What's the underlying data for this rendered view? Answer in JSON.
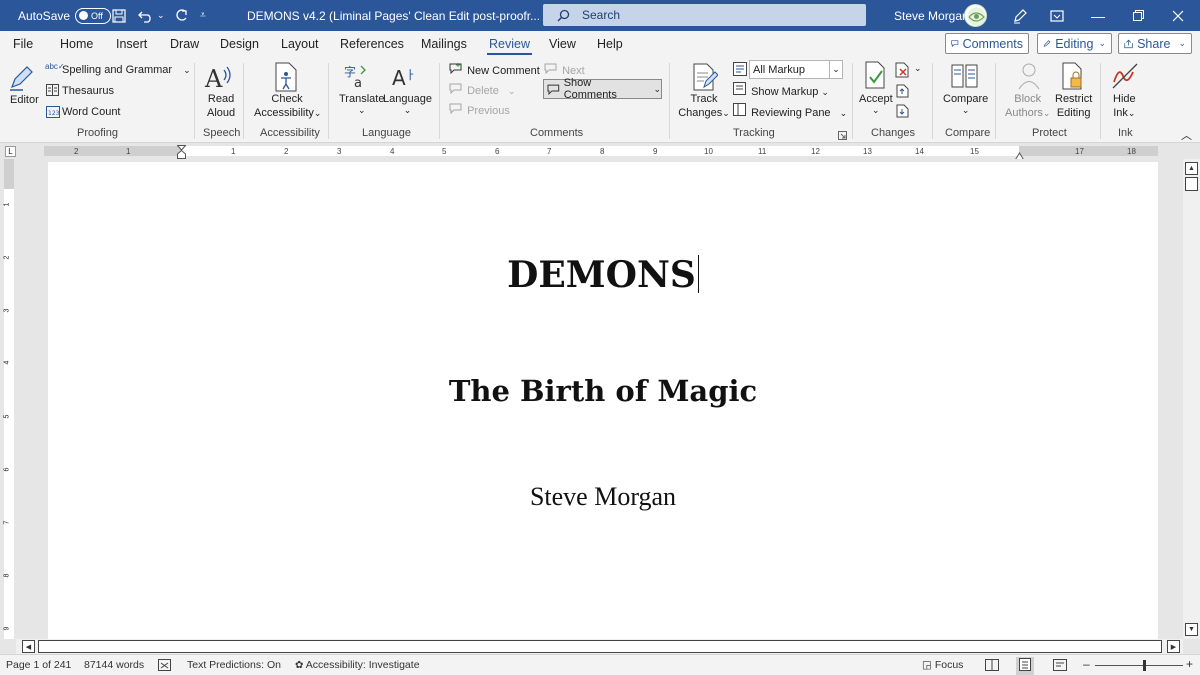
{
  "colors": {
    "accent": "#2b579a",
    "ribbon_bg": "#f3f3f3",
    "page_bg": "#ffffff"
  },
  "titlebar": {
    "autosave_label": "AutoSave",
    "autosave_state": "Off",
    "document_title": "DEMONS v4.2 (Liminal Pages' Clean Edit post-proofr...",
    "search_placeholder": "Search",
    "user_name": "Steve Morgan"
  },
  "tabs": [
    "File",
    "Home",
    "Insert",
    "Draw",
    "Design",
    "Layout",
    "References",
    "Mailings",
    "Review",
    "View",
    "Help"
  ],
  "active_tab": "Review",
  "top_buttons": {
    "comments": "Comments",
    "editing": "Editing",
    "share": "Share"
  },
  "ribbon": {
    "proofing": {
      "spelling": "Spelling and Grammar",
      "thesaurus": "Thesaurus",
      "word_count": "Word Count",
      "editor": "Editor",
      "group": "Proofing"
    },
    "speech": {
      "read_aloud_1": "Read",
      "read_aloud_2": "Aloud",
      "group": "Speech"
    },
    "accessibility": {
      "check_1": "Check",
      "check_2": "Accessibility",
      "group": "Accessibility"
    },
    "language": {
      "translate": "Translate",
      "language": "Language",
      "group": "Language"
    },
    "comments": {
      "new_comment": "New Comment",
      "next": "Next",
      "delete": "Delete",
      "previous": "Previous",
      "show_comments": "Show Comments",
      "group": "Comments"
    },
    "tracking": {
      "track_1": "Track",
      "track_2": "Changes",
      "markup": "All Markup",
      "show_markup": "Show Markup",
      "reviewing_pane": "Reviewing Pane",
      "group": "Tracking"
    },
    "changes": {
      "accept": "Accept",
      "group": "Changes"
    },
    "compare": {
      "compare": "Compare",
      "group": "Compare"
    },
    "protect": {
      "block_1": "Block",
      "block_2": "Authors",
      "restrict_1": "Restrict",
      "restrict_2": "Editing",
      "group": "Protect"
    },
    "ink": {
      "hide_1": "Hide",
      "hide_2": "Ink",
      "group": "Ink"
    }
  },
  "ruler": {
    "numbers": [
      "2",
      "1",
      "1",
      "2",
      "3",
      "4",
      "5",
      "6",
      "7",
      "8",
      "9",
      "10",
      "11",
      "12",
      "13",
      "14",
      "15",
      "17",
      "18"
    ]
  },
  "vruler": {
    "numbers": [
      "1",
      "2",
      "3",
      "4",
      "5",
      "6",
      "7",
      "8",
      "9"
    ]
  },
  "document": {
    "title": "DEMONS",
    "subtitle": "The Birth of Magic",
    "author": "Steve Morgan"
  },
  "status": {
    "page": "Page 1 of 241",
    "words": "87144 words",
    "text_predictions": "Text Predictions: On",
    "accessibility": "Accessibility: Investigate",
    "focus": "Focus"
  }
}
